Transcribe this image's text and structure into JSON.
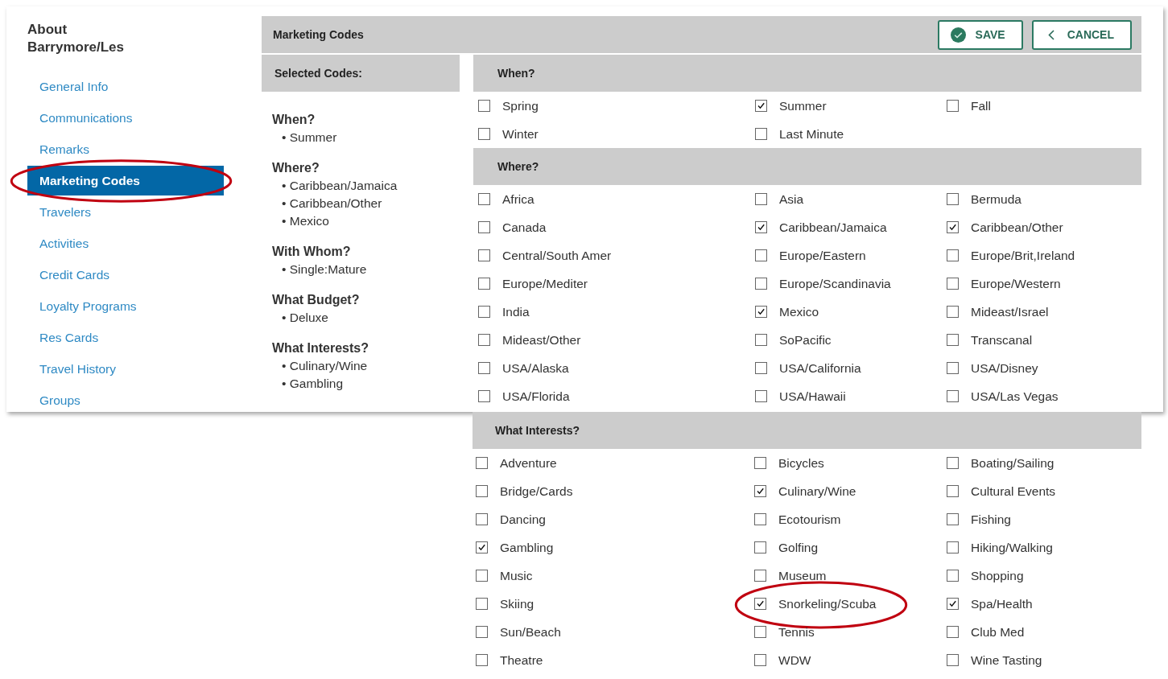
{
  "sidebar": {
    "title": "About Barrymore/Les",
    "items": [
      {
        "label": "General Info",
        "selected": false,
        "circled": false
      },
      {
        "label": "Communications",
        "selected": false,
        "circled": false
      },
      {
        "label": "Remarks",
        "selected": false,
        "circled": false
      },
      {
        "label": "Marketing Codes",
        "selected": true,
        "circled": true
      },
      {
        "label": "Travelers",
        "selected": false,
        "circled": false
      },
      {
        "label": "Activities",
        "selected": false,
        "circled": false
      },
      {
        "label": "Credit Cards",
        "selected": false,
        "circled": false
      },
      {
        "label": "Loyalty Programs",
        "selected": false,
        "circled": false
      },
      {
        "label": "Res Cards",
        "selected": false,
        "circled": false
      },
      {
        "label": "Travel History",
        "selected": false,
        "circled": false
      },
      {
        "label": "Groups",
        "selected": false,
        "circled": false
      }
    ]
  },
  "header": {
    "title": "Marketing Codes",
    "buttons": [
      {
        "label": "SAVE",
        "kind": "save"
      },
      {
        "label": "CANCEL",
        "kind": "cancel"
      }
    ]
  },
  "selected_codes": {
    "title": "Selected Codes:",
    "groups": [
      {
        "title": "When?",
        "items": [
          "• Summer"
        ]
      },
      {
        "title": "Where?",
        "items": [
          "• Caribbean/Jamaica",
          "• Caribbean/Other",
          "• Mexico"
        ]
      },
      {
        "title": "With Whom?",
        "items": [
          "• Single:Mature"
        ]
      },
      {
        "title": "What Budget?",
        "items": [
          "• Deluxe"
        ]
      },
      {
        "title": "What Interests?",
        "items": [
          "• Culinary/Wine",
          "• Gambling"
        ]
      }
    ]
  },
  "sections": [
    {
      "title": "When?",
      "options": [
        {
          "label": "Spring",
          "checked": false,
          "circled": false
        },
        {
          "label": "Summer",
          "checked": true,
          "circled": false
        },
        {
          "label": "Fall",
          "checked": false,
          "circled": false
        },
        {
          "label": "Winter",
          "checked": false,
          "circled": false
        },
        {
          "label": "Last Minute",
          "checked": false,
          "circled": false
        }
      ]
    },
    {
      "title": "Where?",
      "options": [
        {
          "label": "Africa",
          "checked": false,
          "circled": false
        },
        {
          "label": "Asia",
          "checked": false,
          "circled": false
        },
        {
          "label": "Bermuda",
          "checked": false,
          "circled": false
        },
        {
          "label": "Canada",
          "checked": false,
          "circled": false
        },
        {
          "label": "Caribbean/Jamaica",
          "checked": true,
          "circled": false
        },
        {
          "label": "Caribbean/Other",
          "checked": true,
          "circled": false
        },
        {
          "label": "Central/South Amer",
          "checked": false,
          "circled": false
        },
        {
          "label": "Europe/Eastern",
          "checked": false,
          "circled": false
        },
        {
          "label": "Europe/Brit,Ireland",
          "checked": false,
          "circled": false
        },
        {
          "label": "Europe/Mediter",
          "checked": false,
          "circled": false
        },
        {
          "label": "Europe/Scandinavia",
          "checked": false,
          "circled": false
        },
        {
          "label": "Europe/Western",
          "checked": false,
          "circled": false
        },
        {
          "label": "India",
          "checked": false,
          "circled": false
        },
        {
          "label": "Mexico",
          "checked": true,
          "circled": false
        },
        {
          "label": "Mideast/Israel",
          "checked": false,
          "circled": false
        },
        {
          "label": "Mideast/Other",
          "checked": false,
          "circled": false
        },
        {
          "label": "SoPacific",
          "checked": false,
          "circled": false
        },
        {
          "label": "Transcanal",
          "checked": false,
          "circled": false
        },
        {
          "label": "USA/Alaska",
          "checked": false,
          "circled": false
        },
        {
          "label": "USA/California",
          "checked": false,
          "circled": false
        },
        {
          "label": "USA/Disney",
          "checked": false,
          "circled": false
        },
        {
          "label": "USA/Florida",
          "checked": false,
          "circled": false
        },
        {
          "label": "USA/Hawaii",
          "checked": false,
          "circled": false
        },
        {
          "label": "USA/Las Vegas",
          "checked": false,
          "circled": false
        }
      ]
    }
  ],
  "interests": {
    "title": "What Interests?",
    "options": [
      {
        "label": "Adventure",
        "checked": false,
        "circled": false
      },
      {
        "label": "Bicycles",
        "checked": false,
        "circled": false
      },
      {
        "label": "Boating/Sailing",
        "checked": false,
        "circled": false
      },
      {
        "label": "Bridge/Cards",
        "checked": false,
        "circled": false
      },
      {
        "label": "Culinary/Wine",
        "checked": true,
        "circled": false
      },
      {
        "label": "Cultural Events",
        "checked": false,
        "circled": false
      },
      {
        "label": "Dancing",
        "checked": false,
        "circled": false
      },
      {
        "label": "Ecotourism",
        "checked": false,
        "circled": false
      },
      {
        "label": "Fishing",
        "checked": false,
        "circled": false
      },
      {
        "label": "Gambling",
        "checked": true,
        "circled": false
      },
      {
        "label": "Golfing",
        "checked": false,
        "circled": false
      },
      {
        "label": "Hiking/Walking",
        "checked": false,
        "circled": false
      },
      {
        "label": "Music",
        "checked": false,
        "circled": false
      },
      {
        "label": "Museum",
        "checked": false,
        "circled": false
      },
      {
        "label": "Shopping",
        "checked": false,
        "circled": false
      },
      {
        "label": "Skiing",
        "checked": false,
        "circled": false
      },
      {
        "label": "Snorkeling/Scuba",
        "checked": true,
        "circled": true
      },
      {
        "label": "Spa/Health",
        "checked": true,
        "circled": false
      },
      {
        "label": "Sun/Beach",
        "checked": false,
        "circled": false
      },
      {
        "label": "Tennis",
        "checked": false,
        "circled": false
      },
      {
        "label": "Club Med",
        "checked": false,
        "circled": false
      },
      {
        "label": "Theatre",
        "checked": false,
        "circled": false
      },
      {
        "label": "WDW",
        "checked": false,
        "circled": false
      },
      {
        "label": "Wine Tasting",
        "checked": false,
        "circled": false
      }
    ]
  }
}
